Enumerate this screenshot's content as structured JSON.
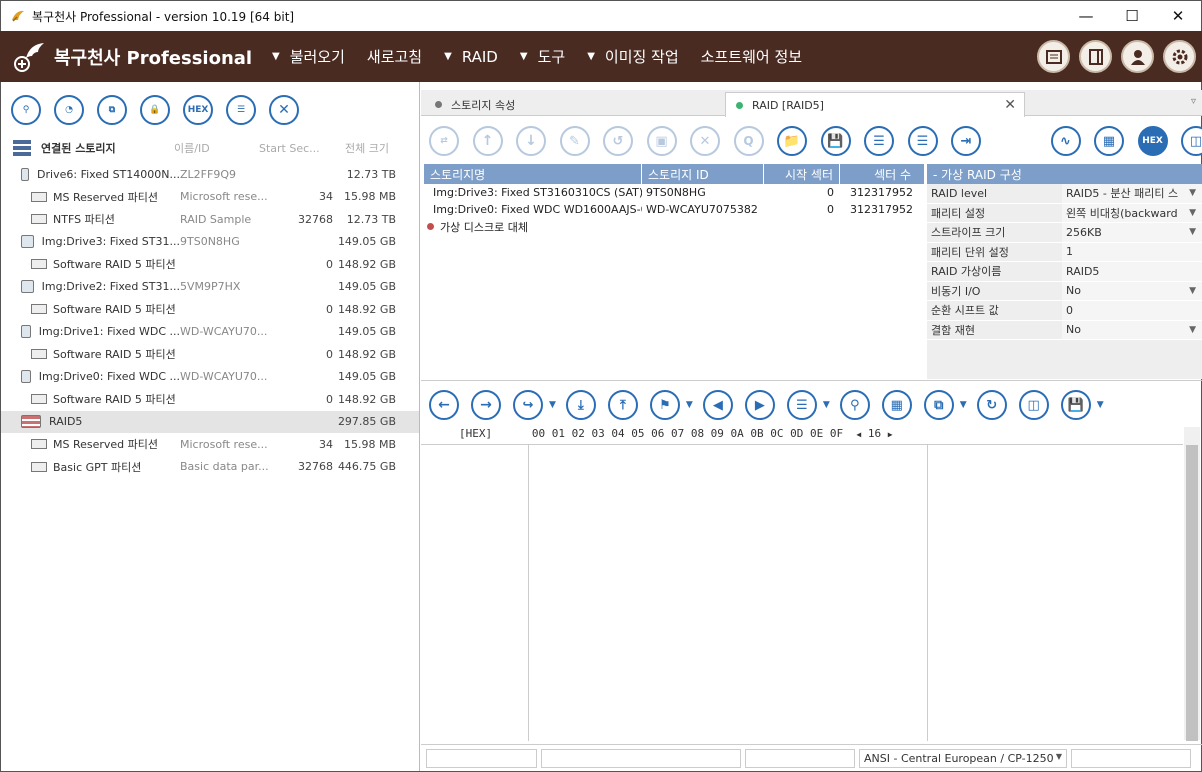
{
  "window": {
    "title": "복구천사 Professional - version 10.19 [64 bit]"
  },
  "header": {
    "logo_text": "복구천사 Professional",
    "menu": [
      {
        "label": "불러오기",
        "arrow": true
      },
      {
        "label": "새로고침",
        "arrow": false
      },
      {
        "label": "RAID",
        "arrow": true
      },
      {
        "label": "도구",
        "arrow": true
      },
      {
        "label": "이미징 작업",
        "arrow": true
      },
      {
        "label": "소프트웨어 정보",
        "arrow": false
      }
    ]
  },
  "left": {
    "toolbar_hex": "HEX",
    "columns": {
      "name": "연결된 스토리지",
      "id": "이름/ID",
      "start": "Start Sec...",
      "size": "전체 크기"
    },
    "tree": [
      {
        "name": "Drive6: Fixed ST14000N...",
        "id": "ZL2FF9Q9",
        "start": "",
        "size": "12.73 TB",
        "level": 0
      },
      {
        "name": "MS Reserved 파티션",
        "id": "Microsoft rese...",
        "start": "34",
        "size": "15.98 MB",
        "level": 1
      },
      {
        "name": "NTFS 파티션",
        "id": "RAID Sample",
        "start": "32768",
        "size": "12.73 TB",
        "level": 1
      },
      {
        "name": "Img:Drive3: Fixed ST31...",
        "id": "9TS0N8HG",
        "start": "",
        "size": "149.05 GB",
        "level": 0
      },
      {
        "name": "Software RAID 5 파티션",
        "id": "",
        "start": "0",
        "size": "148.92 GB",
        "level": 1
      },
      {
        "name": "Img:Drive2: Fixed ST31...",
        "id": "5VM9P7HX",
        "start": "",
        "size": "149.05 GB",
        "level": 0
      },
      {
        "name": "Software RAID 5 파티션",
        "id": "",
        "start": "0",
        "size": "148.92 GB",
        "level": 1
      },
      {
        "name": "Img:Drive1: Fixed WDC ...",
        "id": "WD-WCAYU70...",
        "start": "",
        "size": "149.05 GB",
        "level": 0
      },
      {
        "name": "Software RAID 5 파티션",
        "id": "",
        "start": "0",
        "size": "148.92 GB",
        "level": 1
      },
      {
        "name": "Img:Drive0: Fixed WDC ...",
        "id": "WD-WCAYU70...",
        "start": "",
        "size": "149.05 GB",
        "level": 0
      },
      {
        "name": "Software RAID 5 파티션",
        "id": "",
        "start": "0",
        "size": "148.92 GB",
        "level": 1
      },
      {
        "name": "RAID5",
        "id": "",
        "start": "",
        "size": "297.85 GB",
        "level": 0
      },
      {
        "name": "MS Reserved 파티션",
        "id": "Microsoft rese...",
        "start": "34",
        "size": "15.98 MB",
        "level": 1
      },
      {
        "name": "Basic GPT 파티션",
        "id": "Basic data par...",
        "start": "32768",
        "size": "446.75 GB",
        "level": 1
      }
    ]
  },
  "tabs": [
    {
      "label": "스토리지 속성",
      "dot_color": "#777777"
    },
    {
      "label": "RAID [RAID5]",
      "dot_color": "#3cb371"
    }
  ],
  "right_toolbar_q": "Q",
  "right_toolbar_hex": "HEX",
  "grid": {
    "headers": [
      "스토리지명",
      "스토리지 ID",
      "시작 섹터",
      "섹터 수"
    ],
    "rows": [
      {
        "name": "Img:Drive3: Fixed ST3160310CS (SAT)",
        "id": "9TS0N8HG",
        "start": "0",
        "count": "312317952",
        "dot": "#4a90c8"
      },
      {
        "name": "Img:Drive0: Fixed WDC WD1600AAJS-0...",
        "id": "WD-WCAYU7075382",
        "start": "0",
        "count": "312317952",
        "dot": "#4a90c8"
      },
      {
        "name": "가상 디스크로 대체",
        "id": "",
        "start": "",
        "count": "",
        "dot": "#c0504d"
      }
    ]
  },
  "props": {
    "title": "-  가상 RAID 구성",
    "rows": [
      {
        "key": "RAID level",
        "value": "RAID5 - 분산 패리티 스",
        "dropdown": true
      },
      {
        "key": "패리티 설정",
        "value": "왼쪽 비대칭(backward",
        "dropdown": true
      },
      {
        "key": "스트라이프 크기",
        "value": "256KB",
        "dropdown": true
      },
      {
        "key": "패리티 단위 설정",
        "value": "1",
        "dropdown": false
      },
      {
        "key": "RAID 가상이름",
        "value": "RAID5",
        "dropdown": false
      },
      {
        "key": "비동기 I/O",
        "value": "No",
        "dropdown": true
      },
      {
        "key": "순환 시프트 값",
        "value": "0",
        "dropdown": false
      },
      {
        "key": "결함 재현",
        "value": "No",
        "dropdown": true
      }
    ]
  },
  "hex": {
    "label": "[HEX]",
    "columns": "00 01 02 03 04 05 06 07 08 09 0A 0B 0C 0D 0E 0F",
    "width": "16"
  },
  "status": {
    "encoding": "ANSI - Central European / CP-1250"
  }
}
